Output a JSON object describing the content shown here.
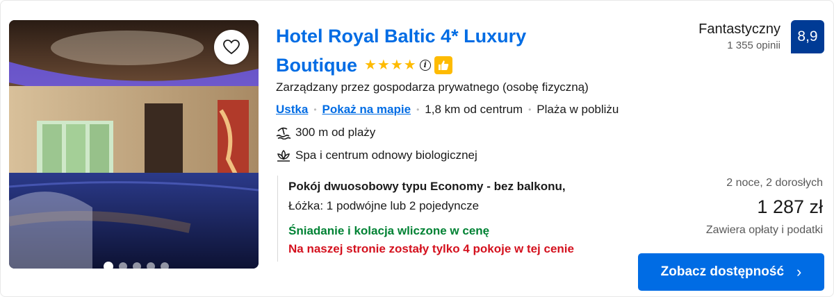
{
  "hotel": {
    "name_line1": "Hotel Royal Baltic 4* Luxury",
    "name_line2": "Boutique",
    "stars": 4,
    "managed_by": "Zarządzany przez gospodarza prywatnego (osobę fizyczną)",
    "location": {
      "city": "Ustka",
      "map_link": "Pokaż na mapie",
      "distance": "1,8 km od centrum",
      "beach": "Plaża w pobliżu"
    },
    "features": [
      {
        "icon": "beach-icon",
        "text": "300 m od plaży"
      },
      {
        "icon": "spa-icon",
        "text": "Spa i centrum odnowy biologicznej"
      }
    ]
  },
  "photo": {
    "carousel_dots": 5,
    "active_dot": 0
  },
  "review": {
    "word": "Fantastyczny",
    "count": "1 355 opinii",
    "score": "8,9"
  },
  "offer": {
    "room": "Pokój dwuosobowy typu Economy - bez balkonu,",
    "beds": "Łóżka: 1 podwójne lub 2 pojedyncze",
    "meals": "Śniadanie i kolacja wliczone w cenę",
    "scarcity": "Na naszej stronie zostały tylko 4 pokoje w tej cenie"
  },
  "price": {
    "stay": "2 noce, 2 dorosłych",
    "amount": "1 287 zł",
    "taxes": "Zawiera opłaty i podatki",
    "cta": "Zobacz dostępność"
  },
  "colors": {
    "brand_blue": "#006ce4",
    "score_blue": "#003b95",
    "star_yellow": "#febb02",
    "green": "#008234",
    "red": "#d4111e"
  }
}
